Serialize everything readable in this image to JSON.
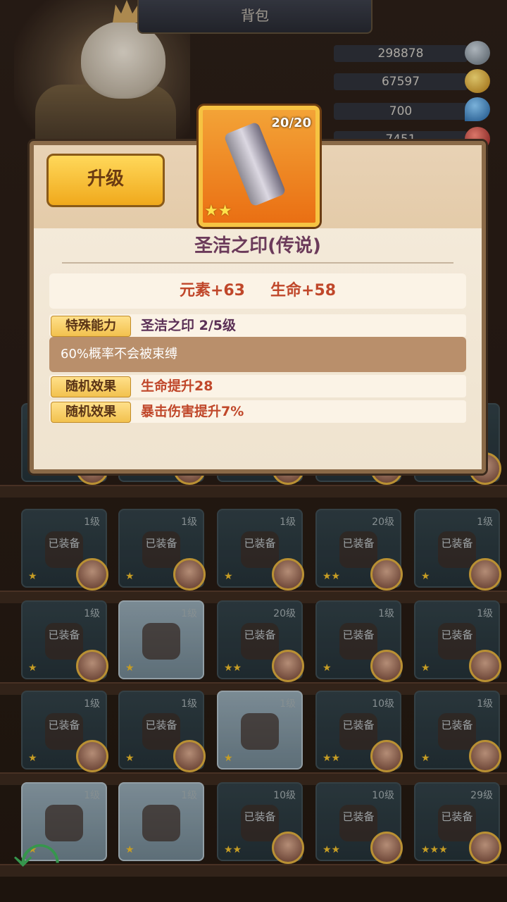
{
  "header": {
    "title": "背包"
  },
  "resources": [
    {
      "value": "298878",
      "icon": "ore-icon",
      "color": "#8a97a3"
    },
    {
      "value": "67597",
      "icon": "coin-icon",
      "color": "#d9a93b"
    },
    {
      "value": "700",
      "icon": "water-drop-icon",
      "color": "#3b8ed1"
    },
    {
      "value": "7451",
      "icon": "gem-icon",
      "color": "#c33a3a"
    }
  ],
  "dialog": {
    "upgrade_label": "升级",
    "item_count": "20/20",
    "item_stars": "★★",
    "item_name": "圣洁之印(传说)",
    "stats": [
      "元素+63",
      "生命+58"
    ],
    "special": {
      "tag": "特殊能力",
      "value": "圣洁之印  2/5级"
    },
    "special_desc": "60%概率不会被束缚",
    "random": [
      {
        "tag": "随机效果",
        "value": "生命提升28"
      },
      {
        "tag": "随机效果",
        "value": "暴击伤害提升7%"
      }
    ]
  },
  "grid": {
    "rows": [
      [
        {
          "lv": "",
          "eq": "",
          "stars": "★★"
        },
        {
          "lv": "",
          "eq": "",
          "stars": "★★"
        },
        {
          "lv": "",
          "eq": "",
          "stars": "★★"
        },
        {
          "lv": "",
          "eq": "",
          "stars": ""
        },
        {
          "lv": "",
          "eq": "",
          "stars": "★"
        }
      ],
      [
        {
          "lv": "1级",
          "eq": "已装备",
          "stars": "★"
        },
        {
          "lv": "1级",
          "eq": "已装备",
          "stars": "★"
        },
        {
          "lv": "1级",
          "eq": "已装备",
          "stars": "★"
        },
        {
          "lv": "20级",
          "eq": "已装备",
          "stars": "★★"
        },
        {
          "lv": "1级",
          "eq": "已装备",
          "stars": "★"
        }
      ],
      [
        {
          "lv": "1级",
          "eq": "已装备",
          "stars": "★"
        },
        {
          "lv": "1级",
          "eq": "",
          "stars": "★"
        },
        {
          "lv": "20级",
          "eq": "已装备",
          "stars": "★★"
        },
        {
          "lv": "1级",
          "eq": "已装备",
          "stars": "★"
        },
        {
          "lv": "1级",
          "eq": "已装备",
          "stars": "★"
        }
      ],
      [
        {
          "lv": "1级",
          "eq": "已装备",
          "stars": "★"
        },
        {
          "lv": "1级",
          "eq": "已装备",
          "stars": "★"
        },
        {
          "lv": "1级",
          "eq": "",
          "stars": "★"
        },
        {
          "lv": "10级",
          "eq": "已装备",
          "stars": "★★"
        },
        {
          "lv": "1级",
          "eq": "已装备",
          "stars": "★"
        }
      ],
      [
        {
          "lv": "1级",
          "eq": "",
          "stars": "★"
        },
        {
          "lv": "1级",
          "eq": "",
          "stars": "★"
        },
        {
          "lv": "10级",
          "eq": "已装备",
          "stars": "★★"
        },
        {
          "lv": "10级",
          "eq": "已装备",
          "stars": "★★"
        },
        {
          "lv": "29级",
          "eq": "已装备",
          "stars": "★★★"
        }
      ]
    ]
  }
}
